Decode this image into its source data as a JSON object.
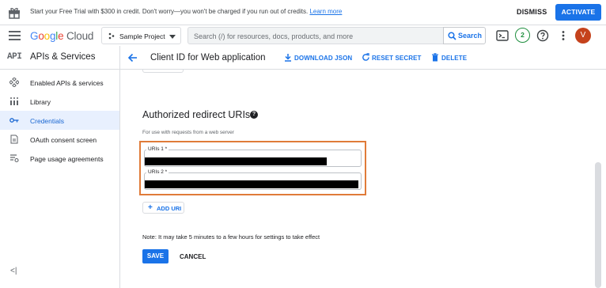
{
  "banner": {
    "message": "Start your Free Trial with $300 in credit. Don't worry—you won't be charged if you run out of credits.",
    "learn_more": "Learn more",
    "dismiss": "DISMISS",
    "activate": "ACTIVATE"
  },
  "header": {
    "logo_google": [
      "G",
      "o",
      "o",
      "g",
      "l",
      "e"
    ],
    "logo_cloud": "Cloud",
    "project": "Sample Project",
    "search_placeholder": "Search (/) for resources, docs, products, and more",
    "search_button": "Search",
    "notifications_count": "2",
    "avatar_initial": "V"
  },
  "sidebar": {
    "badge": "API",
    "title": "APIs & Services",
    "items": [
      {
        "label": "Enabled APIs & services",
        "icon": "diamond-grid-icon",
        "active": false
      },
      {
        "label": "Library",
        "icon": "library-icon",
        "active": false
      },
      {
        "label": "Credentials",
        "icon": "key-icon",
        "active": true
      },
      {
        "label": "OAuth consent screen",
        "icon": "consent-icon",
        "active": false
      },
      {
        "label": "Page usage agreements",
        "icon": "settings-list-icon",
        "active": false
      }
    ],
    "collapse": "<|"
  },
  "main": {
    "title": "Client ID for Web application",
    "actions": {
      "download": "DOWNLOAD JSON",
      "reset": "RESET SECRET",
      "delete": "DELETE"
    },
    "section_title": "Authorized redirect URIs",
    "hint": "For use with requests from a web server",
    "uris": [
      {
        "label": "URIs 1 *",
        "value": "████████████████████"
      },
      {
        "label": "URIs 2 *",
        "value": "████████████████████"
      }
    ],
    "add_uri": "ADD URI",
    "note": "Note: It may take 5 minutes to a few hours for settings to take effect",
    "save": "SAVE",
    "cancel": "CANCEL"
  },
  "colors": {
    "accent": "#1a73e8",
    "highlight_border": "#e07b39",
    "avatar": "#c5421c",
    "badge_green": "#1e8e3e"
  }
}
